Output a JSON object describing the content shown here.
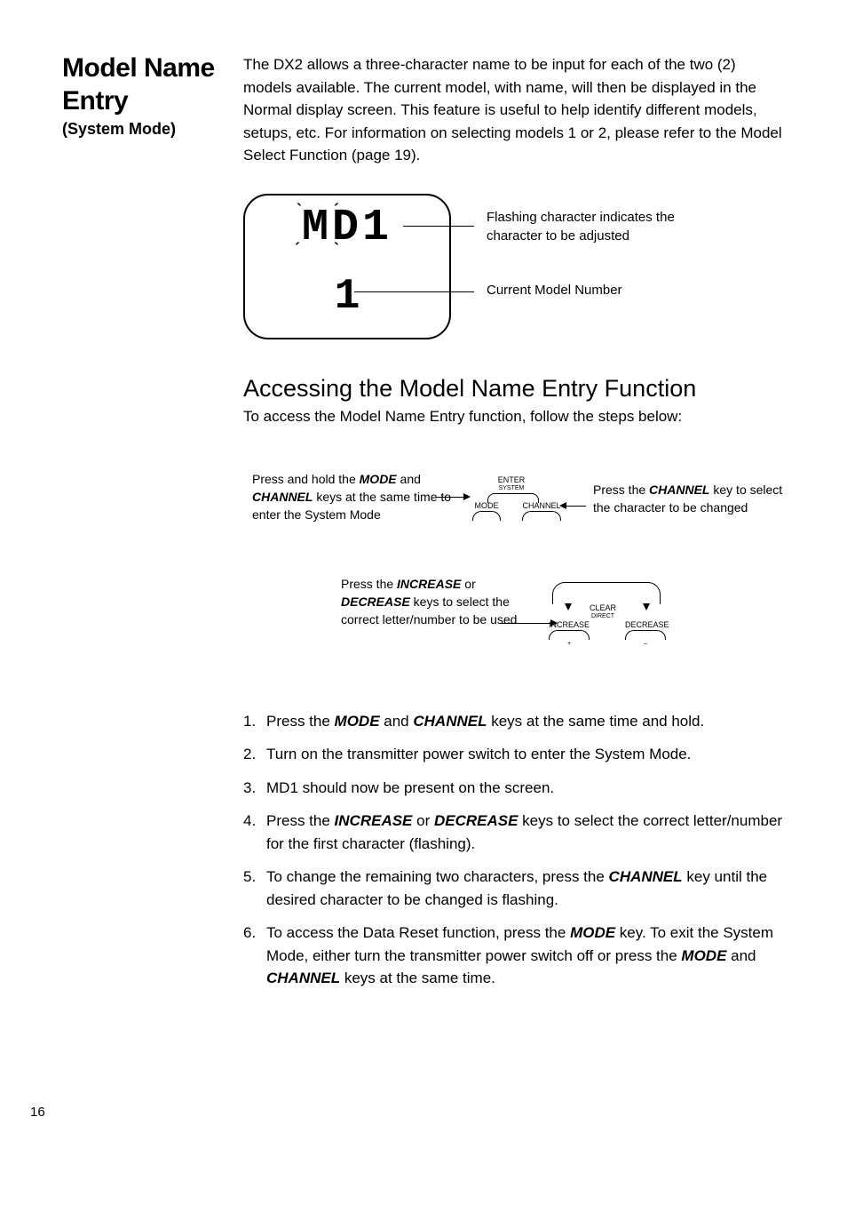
{
  "page_number": "16",
  "heading": {
    "title_line1": "Model Name",
    "title_line2": "Entry",
    "subtitle": "(System Mode)"
  },
  "intro_paragraph": "The DX2 allows a three-character name to be input for each of the two (2) models available. The current model, with name, will then be displayed in the Normal display screen. This feature is useful to help identify different models, setups, etc. For information on selecting models 1 or 2, please refer to the Model Select Function (page 19).",
  "lcd": {
    "name": "MD1",
    "model_num": "1",
    "callout_flash": "Flashing character indicates the character to be adjusted",
    "callout_model": "Current Model Number"
  },
  "section_heading": "Accessing the Model Name Entry Function",
  "section_sub": "To access the Model Name Entry function, follow the steps below:",
  "diagram": {
    "left_note_pre": "Press and hold the ",
    "left_note_bold1": "MODE",
    "left_note_mid1": " and ",
    "left_note_bold2": "CHANNEL",
    "left_note_post": " keys at the same time to enter the System Mode",
    "right_note_pre": "Press the ",
    "right_note_bold": "CHANNEL",
    "right_note_post": " key to select the character to be changed",
    "center_note_pre": "Press the ",
    "center_note_bold1": "INCREASE",
    "center_note_mid": " or ",
    "center_note_bold2": "DECREASE",
    "center_note_post": " keys to select the correct letter/number to be used",
    "labels": {
      "enter": "ENTER",
      "system": "SYSTEM",
      "mode": "MODE",
      "channel": "CHANNEL",
      "clear": "CLEAR",
      "direct": "DIRECT",
      "increase": "INCREASE",
      "decrease": "DECREASE",
      "plus": "+",
      "minus": "–"
    }
  },
  "steps": [
    {
      "num": "1.",
      "pre": "Press the ",
      "b1": "MODE",
      "mid": " and ",
      "b2": "CHANNEL",
      "post": " keys at the same time and hold."
    },
    {
      "num": "2.",
      "plain": "Turn on the transmitter power switch to enter the System Mode."
    },
    {
      "num": "3.",
      "plain": "MD1 should now be present on the screen."
    },
    {
      "num": "4.",
      "pre": "Press the ",
      "b1": "INCREASE",
      "mid": " or ",
      "b2": "DECREASE",
      "post": " keys to select the correct letter/number for the first character (flashing)."
    },
    {
      "num": "5.",
      "pre": "To change the remaining two characters, press the ",
      "b1": "CHANNEL",
      "post": " key until the desired character to be changed is flashing."
    },
    {
      "num": "6.",
      "pre": "To access the Data Reset function, press the ",
      "b1": "MODE",
      "mid": " key. To exit the System Mode, either turn the transmitter power switch off or press the ",
      "b2": "MODE",
      "mid2": " and ",
      "b3": "CHANNEL",
      "post": " keys at the same time."
    }
  ]
}
